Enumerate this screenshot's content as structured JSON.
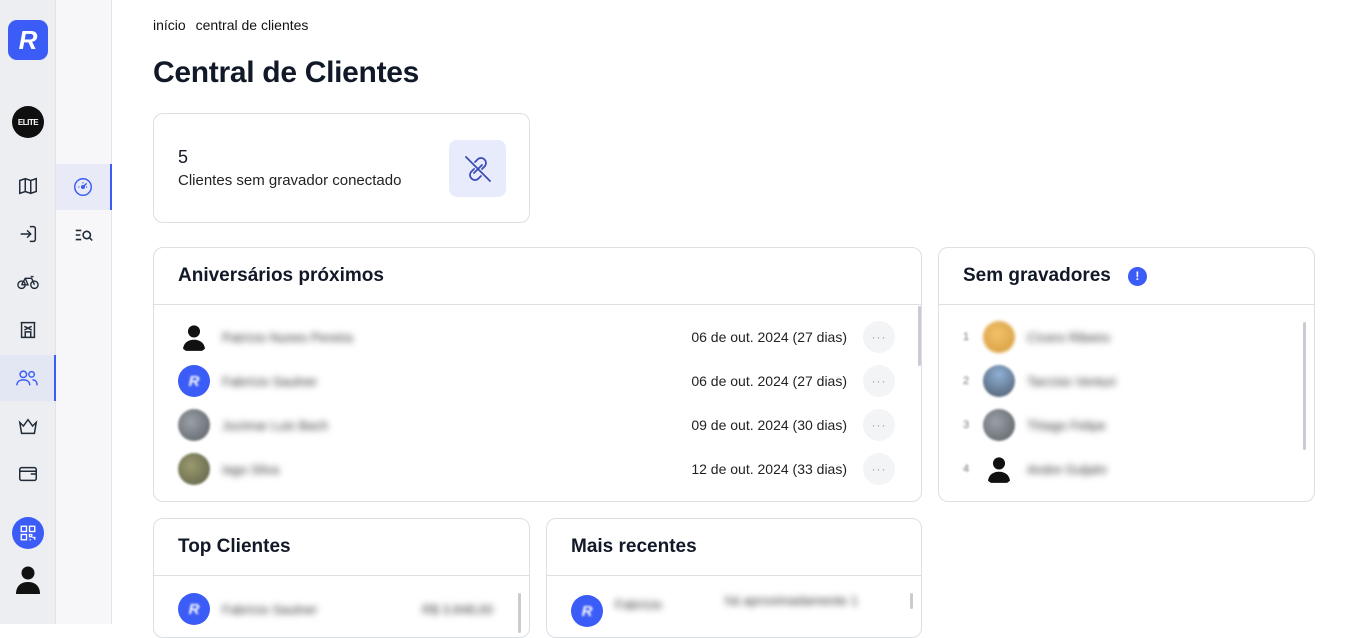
{
  "app": {
    "logo_letter": "R",
    "team_logo_text": "ELITE"
  },
  "rail": {
    "icons": [
      {
        "name": "map-icon",
        "active": false
      },
      {
        "name": "login-icon",
        "active": false
      },
      {
        "name": "bicycle-icon",
        "active": false
      },
      {
        "name": "store-icon",
        "active": false
      },
      {
        "name": "users-icon",
        "active": true
      },
      {
        "name": "crown-icon",
        "active": false
      },
      {
        "name": "wallet-icon",
        "active": false
      }
    ]
  },
  "subrail": {
    "icons": [
      {
        "name": "dashboard-gauge-icon",
        "active": true
      },
      {
        "name": "list-search-icon",
        "active": false
      }
    ]
  },
  "breadcrumb": {
    "home": "início",
    "current": "central de clientes"
  },
  "page_title": "Central de Clientes",
  "stat_card": {
    "value": "5",
    "label": "Clientes sem gravador conectado",
    "icon": "broken-link-icon"
  },
  "birthdays": {
    "title": "Aniversários próximos",
    "rows": [
      {
        "name": "Patrício Nunes Pereira",
        "date": "06 de out. 2024 (27 dias)",
        "avatar": "silhouette"
      },
      {
        "name": "Fabrício Saulner",
        "date": "06 de out. 2024 (27 dias)",
        "avatar": "blue"
      },
      {
        "name": "Jucimar Luis Bach",
        "date": "09 de out. 2024 (30 dias)",
        "avatar": "grey"
      },
      {
        "name": "Iago Silva",
        "date": "12 de out. 2024 (33 dias)",
        "avatar": "olive"
      }
    ],
    "more_label": "···"
  },
  "no_recorders": {
    "title": "Sem gravadores",
    "badge": "!",
    "rows": [
      {
        "rank": "1",
        "name": "Cícero Ribeiro",
        "avatar": "gold"
      },
      {
        "rank": "2",
        "name": "Tarcísio Venturi",
        "avatar": "sky"
      },
      {
        "rank": "3",
        "name": "Thiago Felipe",
        "avatar": "grey"
      },
      {
        "rank": "4",
        "name": "Andre Guljahr",
        "avatar": "silhouette"
      }
    ]
  },
  "top_clients": {
    "title": "Top Clientes",
    "rows": [
      {
        "name": "Fabrício Saulner",
        "value": "R$ 3.848,00",
        "avatar": "blue"
      }
    ]
  },
  "recent": {
    "title": "Mais recentes",
    "rows": [
      {
        "name": "Fabrício",
        "time": "há aproximadamente 1",
        "avatar": "blue"
      }
    ]
  }
}
